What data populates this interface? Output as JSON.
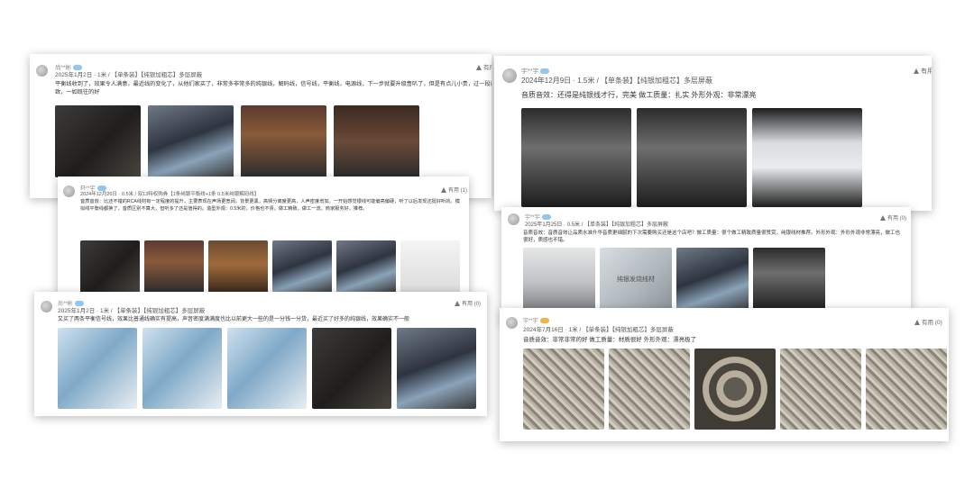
{
  "cards": [
    {
      "user": "尚**彬",
      "meta": "2025年1月2日 · 1米 / 【单条装】【纯银加粗芯】多层屏蔽",
      "useful": "有用",
      "review": "平衡线收到了，效果令人满意，最近线的变化了，从他们家买了，非常多非常多的纯银线，解码线，信号线，平衡线，电源线，下一步就要升级嗇叭了，但是有点儿小贵，过一段再买。做工精致，一如既往的好",
      "images": [
        "",
        "",
        "",
        ""
      ]
    },
    {
      "user": "轩**宇",
      "meta": "2024年12月26日 · 0.5米 / 双13特权购券【1条纯银平衡线+1条 0.5米纯银解码线】",
      "useful": "有用 (1)",
      "review": "音质音效：比还不错的RCA线材有一定程度的提升，主要表现在声场更宽阔，背景更黑，高频分离度更高，人声密度增加。一开始感觉银线可能偏亮偏硬，听了以后发现还挺好听的。模拟线平衡线都换了，音质区别不算大，但听多了还是值得的。造型外观：0.5米的，价格也不贵。做工精致，做工一流。商家服务好，推荐。",
      "images": [
        "",
        "",
        "",
        "",
        "",
        ""
      ]
    },
    {
      "user": "尚**彬",
      "meta": "2025年1月2日 · 1米 / 【单条装】【纯银加粗芯】多层屏蔽",
      "useful": "有用 (0)",
      "review": "又买了两条平衡信号线，效果比普通线确实有提高，声音密度满满度也比以前更大一些的是一分钱一分货，最近买了好多的纯银线，效果确实不一般",
      "images": [
        "",
        "",
        "",
        "",
        ""
      ]
    },
    {
      "user": "宇**宇",
      "meta": "2024年12月9日 · 1.5米 / 【单条装】【纯银加粗芯】多层屏蔽",
      "useful": "有用",
      "review": "音质音效：还得是纯银线才行，完美 做工质量：扎实 外形外观：非常漂亮",
      "images": [
        "",
        "",
        ""
      ]
    },
    {
      "user": "宇**宇",
      "meta": "2025年1月25日 · 0.5米 / 【单条装】【纯银加粗芯】多层屏蔽",
      "useful": "有用 (0)",
      "review": "音质音效：音质音效让品质水准升华音质更细腻的下次需要购买还是这个店吧？做工质量：很个做工精致质量很赞赏，纯银线材推荐。外形外观：外形外观非常漂亮，做工也很好，质感也不错。",
      "images": [
        "",
        "纯银发烧线材",
        "",
        ""
      ]
    },
    {
      "user": "宇**宇",
      "meta": "2024年7月16日 · 1米 / 【单条装】【纯银加粗芯】多层屏蔽",
      "useful": "有用 (0)",
      "review": "音质音效：非常非常的好 做工质量：材质很好 外形外观：漂亮极了",
      "images": [
        "",
        "",
        "",
        "",
        ""
      ]
    }
  ]
}
